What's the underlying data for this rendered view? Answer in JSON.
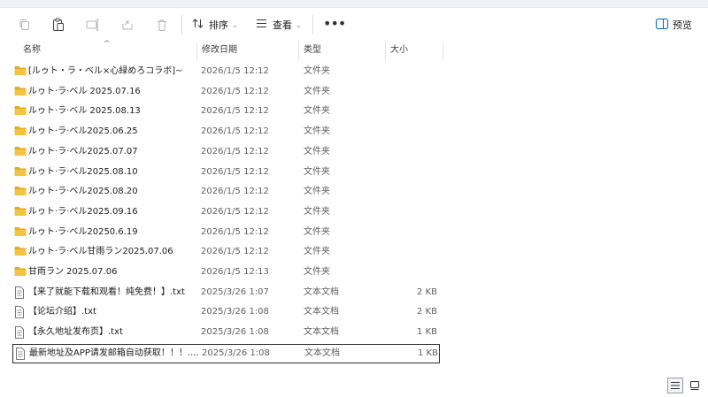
{
  "toolbar": {
    "icons": [
      "copy-icon",
      "paste-icon",
      "rename-icon",
      "share-icon",
      "delete-icon"
    ],
    "sort_label": "排序",
    "view_label": "查看",
    "more_label": "•••",
    "preview_label": "预览"
  },
  "columns": {
    "name": "名称",
    "date": "修改日期",
    "type": "类型",
    "size": "大小"
  },
  "files": [
    {
      "name": "[ルゥト・ラ・ベル×心緑めろコラボ]~",
      "date": "2026/1/5 12:12",
      "type": "文件夹",
      "size": "",
      "kind": "folder"
    },
    {
      "name": "ルゥト·ラ·ベル 2025.07.16",
      "date": "2026/1/5 12:12",
      "type": "文件夹",
      "size": "",
      "kind": "folder"
    },
    {
      "name": "ルゥト·ラ·ベル 2025.08.13",
      "date": "2026/1/5 12:12",
      "type": "文件夹",
      "size": "",
      "kind": "folder"
    },
    {
      "name": "ルゥト·ラ·ベル2025.06.25",
      "date": "2026/1/5 12:12",
      "type": "文件夹",
      "size": "",
      "kind": "folder"
    },
    {
      "name": "ルゥト·ラ·ベル2025.07.07",
      "date": "2026/1/5 12:12",
      "type": "文件夹",
      "size": "",
      "kind": "folder"
    },
    {
      "name": "ルゥト·ラ·ベル2025.08.10",
      "date": "2026/1/5 12:12",
      "type": "文件夹",
      "size": "",
      "kind": "folder"
    },
    {
      "name": "ルゥト·ラ·ベル2025.08.20",
      "date": "2026/1/5 12:12",
      "type": "文件夹",
      "size": "",
      "kind": "folder"
    },
    {
      "name": "ルゥト·ラ·ベル2025.09.16",
      "date": "2026/1/5 12:12",
      "type": "文件夹",
      "size": "",
      "kind": "folder"
    },
    {
      "name": "ルゥト·ラ·ベル20250.6.19",
      "date": "2026/1/5 12:12",
      "type": "文件夹",
      "size": "",
      "kind": "folder"
    },
    {
      "name": "ルゥト·ラ·ベル甘雨ラン2025.07.06",
      "date": "2026/1/5 12:12",
      "type": "文件夹",
      "size": "",
      "kind": "folder"
    },
    {
      "name": "甘雨ラン 2025.07.06",
      "date": "2026/1/5 12:13",
      "type": "文件夹",
      "size": "",
      "kind": "folder"
    },
    {
      "name": "【来了就能下载和观看！纯免费！】.txt",
      "date": "2025/3/26 1:07",
      "type": "文本文档",
      "size": "2 KB",
      "kind": "txt"
    },
    {
      "name": "【论坛介绍】.txt",
      "date": "2025/3/26 1:08",
      "type": "文本文档",
      "size": "2 KB",
      "kind": "txt"
    },
    {
      "name": "【永久地址发布页】.txt",
      "date": "2025/3/26 1:08",
      "type": "文本文档",
      "size": "1 KB",
      "kind": "txt"
    },
    {
      "name": "最新地址及APP请发邮箱自动获取！！！....",
      "date": "2025/3/26 1:08",
      "type": "文本文档",
      "size": "1 KB",
      "kind": "txt"
    }
  ],
  "colors": {
    "folder": "#f5c342",
    "folder_tab": "#e7a91d",
    "accent": "#0067c0"
  },
  "view_buttons": [
    "details-view-icon",
    "large-icons-view-icon"
  ]
}
